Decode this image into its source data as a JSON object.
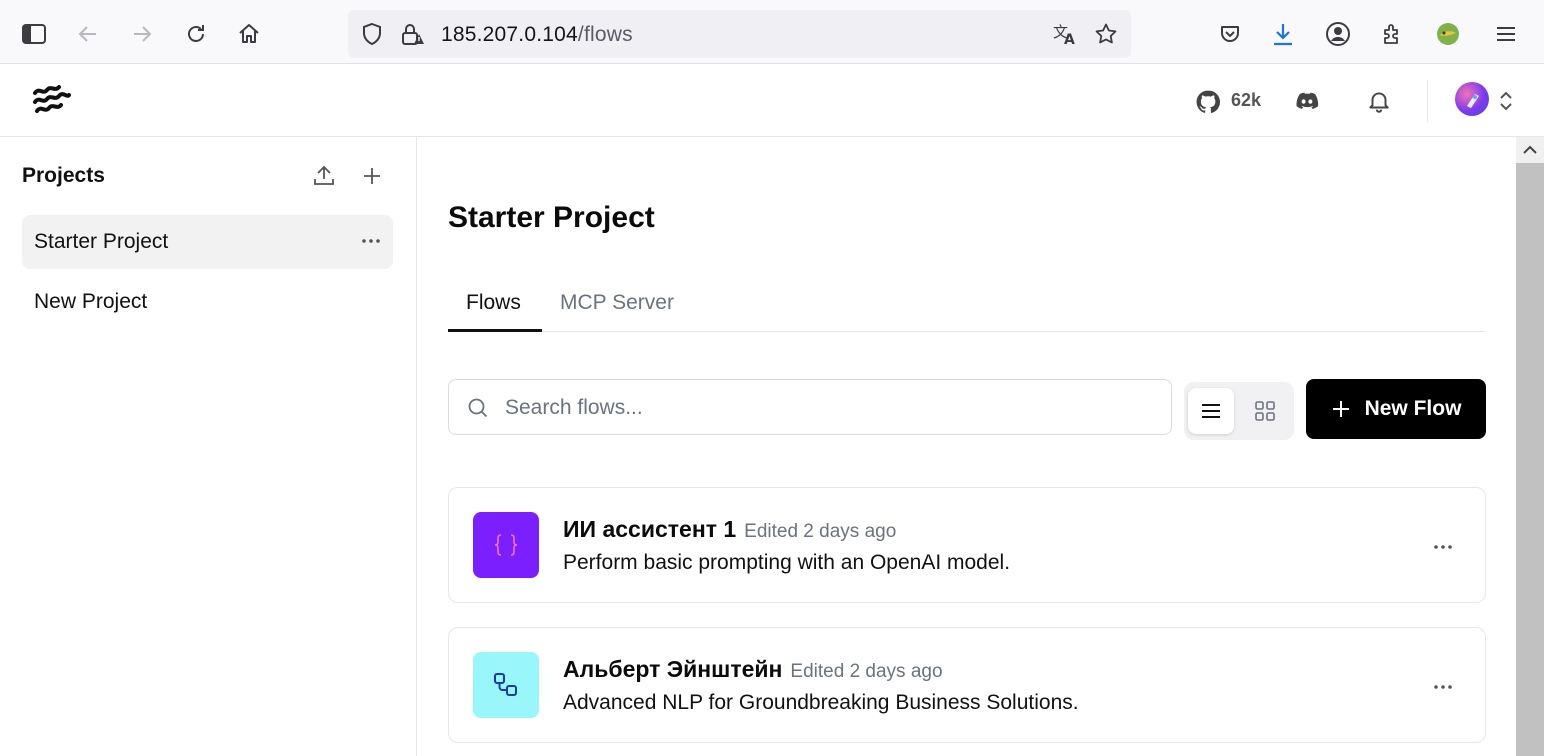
{
  "browser": {
    "url_host": "185.207.0.104",
    "url_path": "/flows",
    "icons": [
      "sidebar-icon",
      "back-icon",
      "forward-icon",
      "reload-icon",
      "home-icon",
      "shield-icon",
      "lock-warning-icon",
      "translate-icon",
      "star-icon",
      "pocket-icon",
      "download-icon",
      "account-icon",
      "extensions-icon",
      "extension-badge-icon",
      "menu-icon"
    ]
  },
  "header": {
    "github_stars": "62k",
    "icons": [
      "langflow-logo",
      "github-icon",
      "discord-icon",
      "bell-icon",
      "avatar",
      "chevron-updown-icon"
    ]
  },
  "sidebar": {
    "title": "Projects",
    "projects": [
      {
        "label": "Starter Project",
        "active": true
      },
      {
        "label": "New Project",
        "active": false
      }
    ]
  },
  "main": {
    "title": "Starter Project",
    "tabs": [
      {
        "label": "Flows",
        "active": true
      },
      {
        "label": "MCP Server",
        "active": false
      }
    ],
    "search_placeholder": "Search flows...",
    "new_flow_label": "New Flow",
    "flows": [
      {
        "name": "ИИ ассистент 1",
        "edited": "Edited 2 days ago",
        "description": "Perform basic prompting with an OpenAI model.",
        "icon": "braces-icon",
        "icon_bg": "#7c1fff",
        "icon_color": "#f472b6"
      },
      {
        "name": "Альберт Эйнштейн",
        "edited": "Edited 2 days ago",
        "description": "Advanced NLP for Groundbreaking Business Solutions.",
        "icon": "workflow-icon",
        "icon_bg": "#99f6fb",
        "icon_color": "#1e3aa8"
      }
    ]
  },
  "colors": {
    "primary_button": "#000000",
    "active_project_bg": "#f2f2f3",
    "download_accent": "#1a73e8"
  }
}
